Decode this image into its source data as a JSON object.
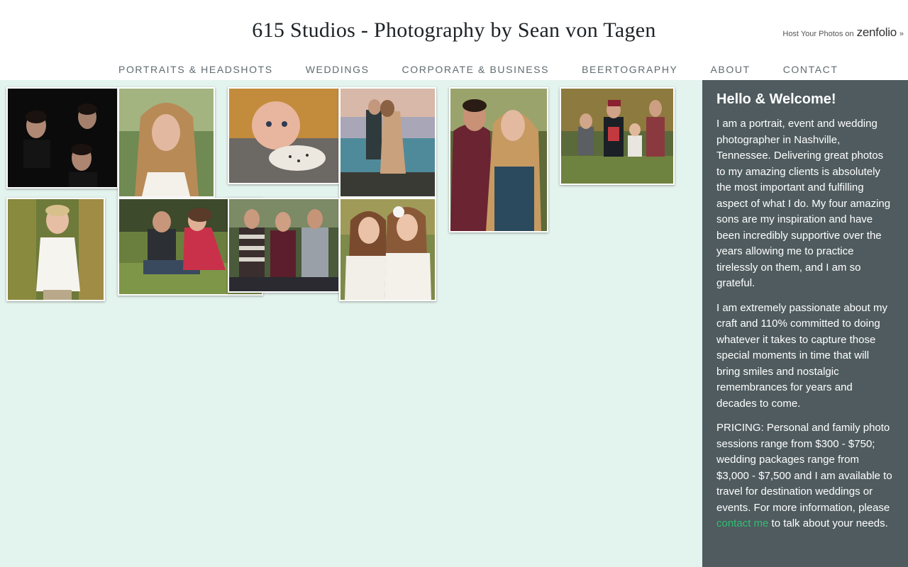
{
  "header": {
    "title": "615 Studios - Photography by Sean von Tagen",
    "host_prefix": "Host Your Photos on",
    "host_brand": "zenfolio",
    "host_arrow": "»"
  },
  "nav": {
    "items": [
      "PORTRAITS & HEADSHOTS",
      "WEDDINGS",
      "CORPORATE & BUSINESS",
      "BEERTOGRAPHY",
      "ABOUT",
      "CONTACT"
    ]
  },
  "gallery": {
    "background_color": "#e3f3ed",
    "photos": [
      {
        "name": "photo-three-brothers-dark"
      },
      {
        "name": "photo-girl-long-hair"
      },
      {
        "name": "photo-baby"
      },
      {
        "name": "photo-couple-beach-kiss"
      },
      {
        "name": "photo-couple-embrace"
      },
      {
        "name": "photo-family-four-kids-grass"
      },
      {
        "name": "photo-boy-white-shirt"
      },
      {
        "name": "photo-couple-sitting-grass"
      },
      {
        "name": "photo-three-young-men"
      },
      {
        "name": "photo-two-girls-sweaters"
      }
    ]
  },
  "sidebar": {
    "background_color": "#4f5b5f",
    "link_color": "#2fbf71",
    "heading": "Hello & Welcome!",
    "p1": "I am a portrait, event and wedding photographer in Nashville, Tennessee. Delivering great photos to my amazing clients is absolutely the most important and fulfilling aspect of what I do. My four amazing sons are my inspiration and have been incredibly supportive over the years allowing me to practice tirelessly on them, and I am so grateful.",
    "p2": "I am extremely passionate about my craft and 110% committed to doing whatever it takes to capture those special moments in time that will bring smiles and nostalgic remembrances for years and decades to come.",
    "p3_before": "PRICING: Personal and family photo sessions range from $300 - $750; wedding packages range from $3,000 - $7,500 and I am available to travel for destination weddings or events. For more information, please ",
    "p3_link": "contact me",
    "p3_after": " to talk about your needs."
  }
}
